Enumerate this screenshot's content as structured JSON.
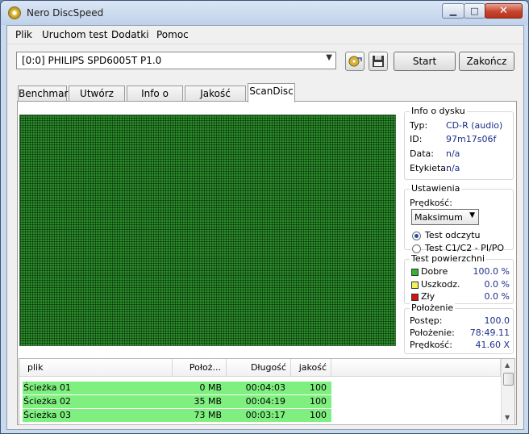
{
  "window": {
    "title": "Nero DiscSpeed",
    "min_glyph": "▁",
    "max_glyph": "□",
    "close_glyph": "✕"
  },
  "menu": [
    "Plik",
    "Uruchom test",
    "Dodatki",
    "Pomoc"
  ],
  "toolbar": {
    "drive": "[0:0]   PHILIPS SPD6005T P1.0",
    "start_label": "Start",
    "exit_label": "Zakończ"
  },
  "tabs": [
    "Benchmark",
    "Utwórz dysk",
    "Info o dysku",
    "Jakość dysku",
    "ScanDisc"
  ],
  "active_tab": "ScanDisc",
  "disc_info": {
    "title": "Info o dysku",
    "type_label": "Typ:",
    "type_value": "CD-R (audio)",
    "id_label": "ID:",
    "id_value": "97m17s06f",
    "date_label": "Data:",
    "date_value": "n/a",
    "label_label": "Etykieta:",
    "label_value": "n/a"
  },
  "settings": {
    "title": "Ustawienia",
    "speed_label": "Prędkość:",
    "speed_value": "Maksimum",
    "radio_read": "Test odczytu",
    "radio_c1c2": "Test C1/C2 - PI/PO",
    "selected": "Test odczytu"
  },
  "surface": {
    "title": "Test powierzchni",
    "good_label": "Dobre",
    "good_value": "100.0 %",
    "damaged_label": "Uszkodz.",
    "damaged_value": "0.0 %",
    "bad_label": "Zły",
    "bad_value": "0.0 %",
    "good_color": "#2fb52f",
    "damaged_color": "#f2f25a",
    "bad_color": "#d01515"
  },
  "position": {
    "title": "Położenie",
    "progress_label": "Postęp:",
    "progress_value": "100.0",
    "pos_label": "Położenie:",
    "pos_value": "78:49.11",
    "speed_label": "Prędkość:",
    "speed_value": "41.60 X"
  },
  "filelist": {
    "headers": [
      "plik",
      "Położ...",
      "Długość",
      "jakość"
    ],
    "rows": [
      {
        "name": "Ścieżka 01",
        "pos": "0 MB",
        "length": "00:04:03",
        "quality": "100"
      },
      {
        "name": "Ścieżka 02",
        "pos": "35 MB",
        "length": "00:04:19",
        "quality": "100"
      },
      {
        "name": "Ścieżka 03",
        "pos": "73 MB",
        "length": "00:03:17",
        "quality": "100"
      }
    ],
    "row_color": "#7ff07f"
  }
}
